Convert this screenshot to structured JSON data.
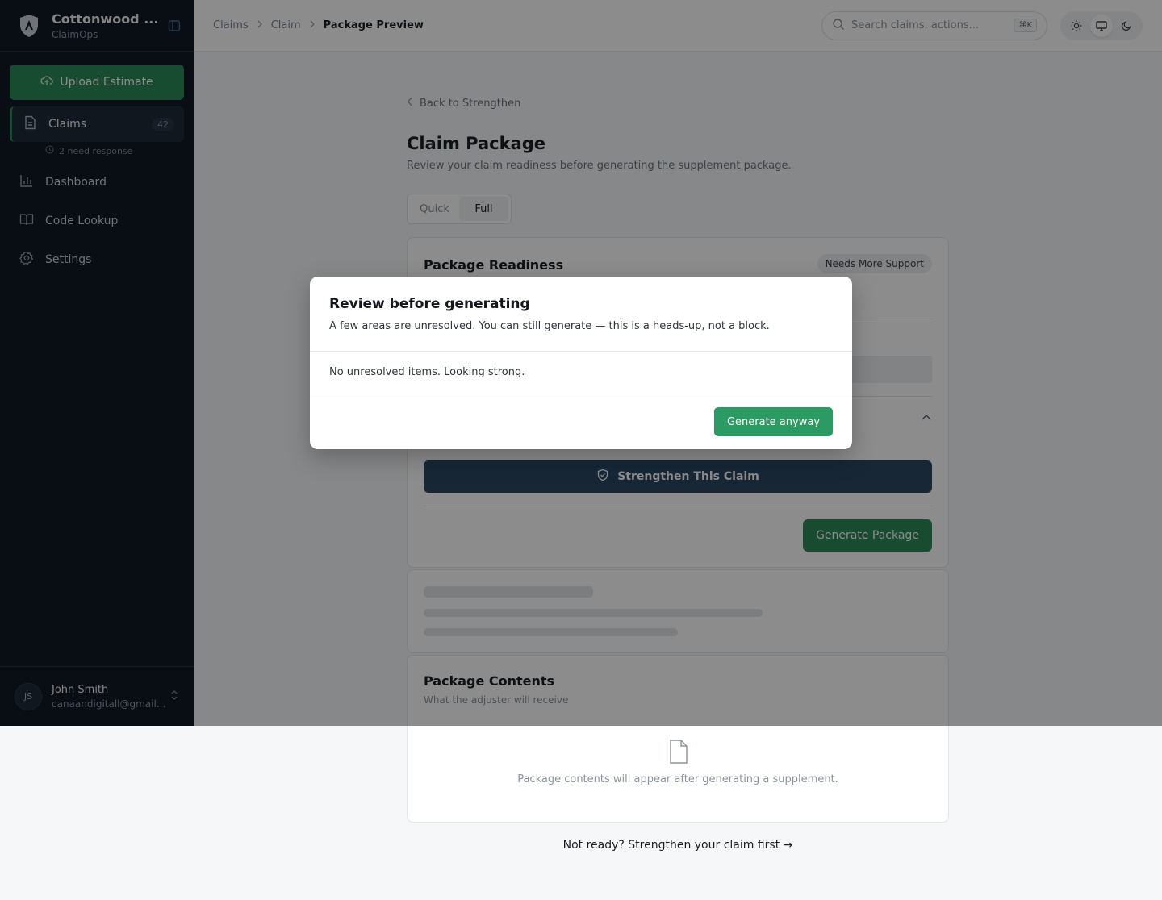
{
  "brand": {
    "name": "Cottonwood ...",
    "sub": "ClaimOps"
  },
  "sidebar": {
    "upload_label": "Upload Estimate",
    "claims": {
      "label": "Claims",
      "count": "42",
      "need_response": "2 need response"
    },
    "items": [
      {
        "label": "Dashboard",
        "icon": "bar-chart-icon"
      },
      {
        "label": "Code Lookup",
        "icon": "book-icon"
      },
      {
        "label": "Settings",
        "icon": "gear-icon"
      }
    ],
    "user": {
      "initials": "JS",
      "name": "John Smith",
      "email": "canaandigitall@gmail..."
    }
  },
  "header": {
    "breadcrumbs": [
      "Claims",
      "Claim",
      "Package Preview"
    ],
    "search_placeholder": "Search claims, actions...",
    "shortcut": "⌘K"
  },
  "main": {
    "back_label": "Back to Strengthen",
    "title": "Claim Package",
    "subtitle": "Review your claim readiness before generating the supplement package.",
    "toggle": {
      "quick": "Quick",
      "full": "Full",
      "selected": "Full"
    },
    "readiness": {
      "title": "Package Readiness",
      "badge": "Needs More Support",
      "strengthen_label": "Strengthen This Claim",
      "generate_label": "Generate Package"
    },
    "contents": {
      "title": "Package Contents",
      "subtitle": "What the adjuster will receive",
      "empty": "Package contents will appear after generating a supplement."
    },
    "not_ready": "Not ready? Strengthen your claim first →"
  },
  "modal": {
    "title": "Review before generating",
    "description": "A few areas are unresolved. You can still generate — this is a heads-up, not a block.",
    "body": "No unresolved items. Looking strong.",
    "confirm_label": "Generate anyway"
  },
  "colors": {
    "accent": "#2c8a5a",
    "sidebar_bg": "#111a26",
    "strengthen_bg": "#2b4763"
  }
}
